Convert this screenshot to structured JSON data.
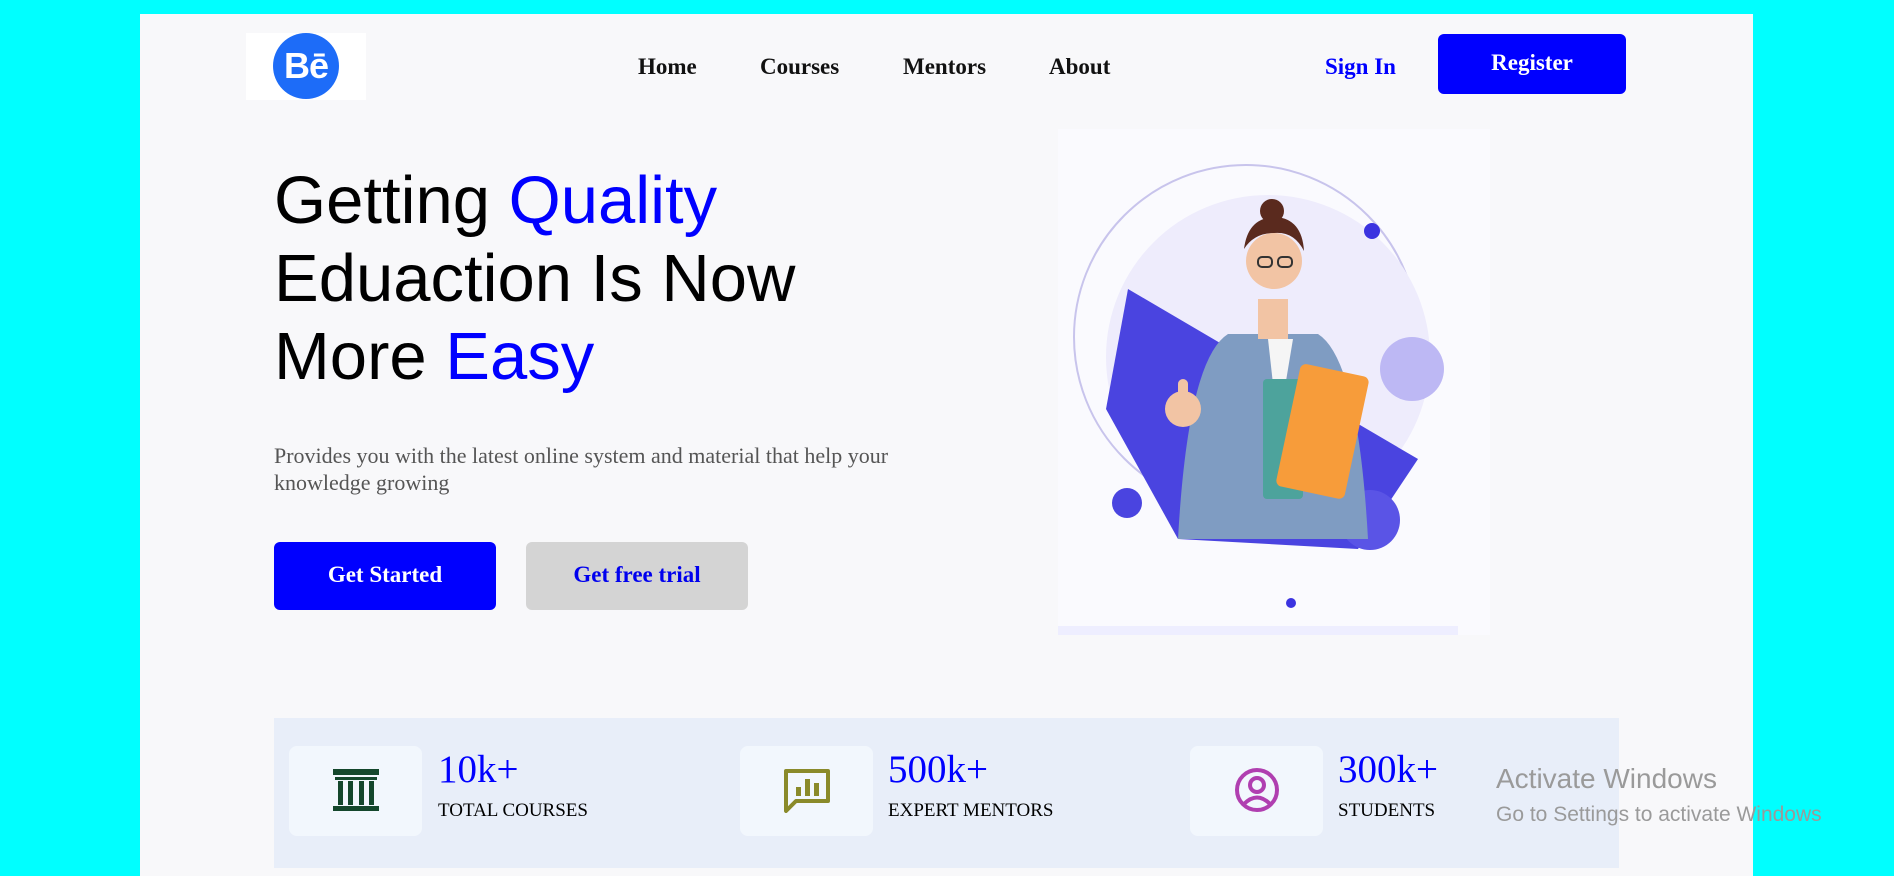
{
  "header": {
    "logo_text": "Bē",
    "nav": [
      "Home",
      "Courses",
      "Mentors",
      "About"
    ],
    "sign_in": "Sign In",
    "register": "Register"
  },
  "hero": {
    "title_line1_a": "Getting ",
    "title_line1_b": "Quality",
    "title_line2": "Eduaction Is Now",
    "title_line3_a": "More ",
    "title_line3_b": "Easy",
    "description": "Provides you with the latest online system and material that help your knowledge growing",
    "cta_primary": "Get Started",
    "cta_secondary": "Get free trial"
  },
  "stats": [
    {
      "value": "10k+",
      "label": "TOTAL COURSES",
      "icon": "building-columns-icon",
      "icon_color": "#14472c"
    },
    {
      "value": "500k+",
      "label": "EXPERT MENTORS",
      "icon": "chart-message-icon",
      "icon_color": "#8a8a2a"
    },
    {
      "value": "300k+",
      "label": "STUDENTS",
      "icon": "user-circle-icon",
      "icon_color": "#b03fb0"
    }
  ],
  "watermark": {
    "line1": "Activate Windows",
    "line2": "Go to Settings to activate Windows"
  },
  "colors": {
    "accent": "#0000ff",
    "background": "#00ffff",
    "page": "#f8f8fa"
  }
}
